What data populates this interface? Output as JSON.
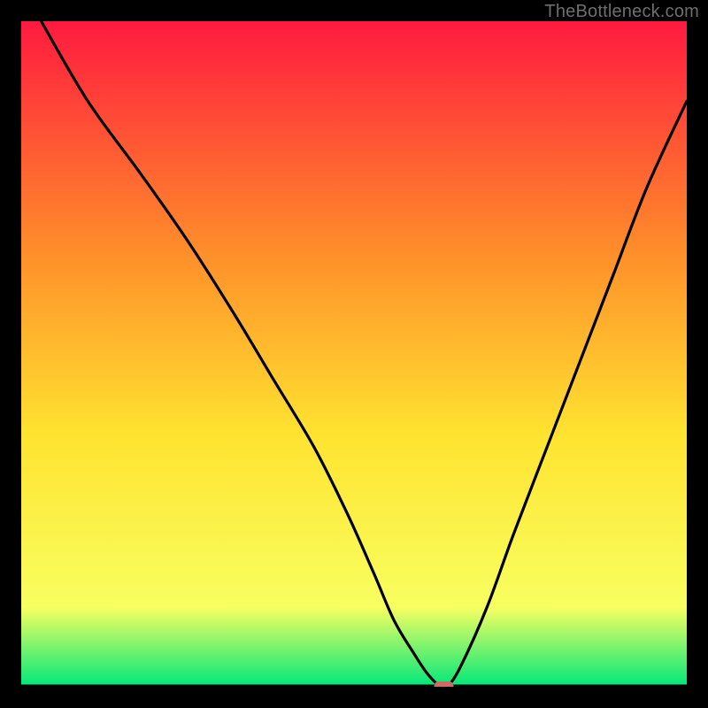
{
  "watermark": "TheBottleneck.com",
  "chart_data": {
    "type": "line",
    "title": "",
    "xlabel": "",
    "ylabel": "",
    "xlim": [
      0,
      100
    ],
    "ylim": [
      0,
      100
    ],
    "grid": false,
    "legend": false,
    "background_gradient": {
      "top": "#ff1a3f",
      "mid_top": "#ff8f2a",
      "mid": "#ffe330",
      "mid_bottom": "#f8ff60",
      "bottom": "#00e77a"
    },
    "series": [
      {
        "name": "bottleneck-curve",
        "x": [
          3,
          10,
          18,
          25,
          32,
          38,
          44,
          49,
          53,
          56,
          59,
          61,
          63,
          64,
          66,
          70,
          74,
          79,
          84,
          89,
          94,
          100
        ],
        "y": [
          100,
          88,
          77,
          67,
          56,
          46,
          36,
          26,
          17,
          10,
          5,
          2,
          0,
          0,
          3,
          12,
          23,
          36,
          49,
          62,
          75,
          88
        ]
      }
    ],
    "marker": {
      "name": "optimum-marker",
      "x": 63.5,
      "y": 0,
      "color": "#d06a66",
      "shape": "rounded-rect"
    },
    "baseline": {
      "y": 0,
      "color": "#000000"
    }
  }
}
